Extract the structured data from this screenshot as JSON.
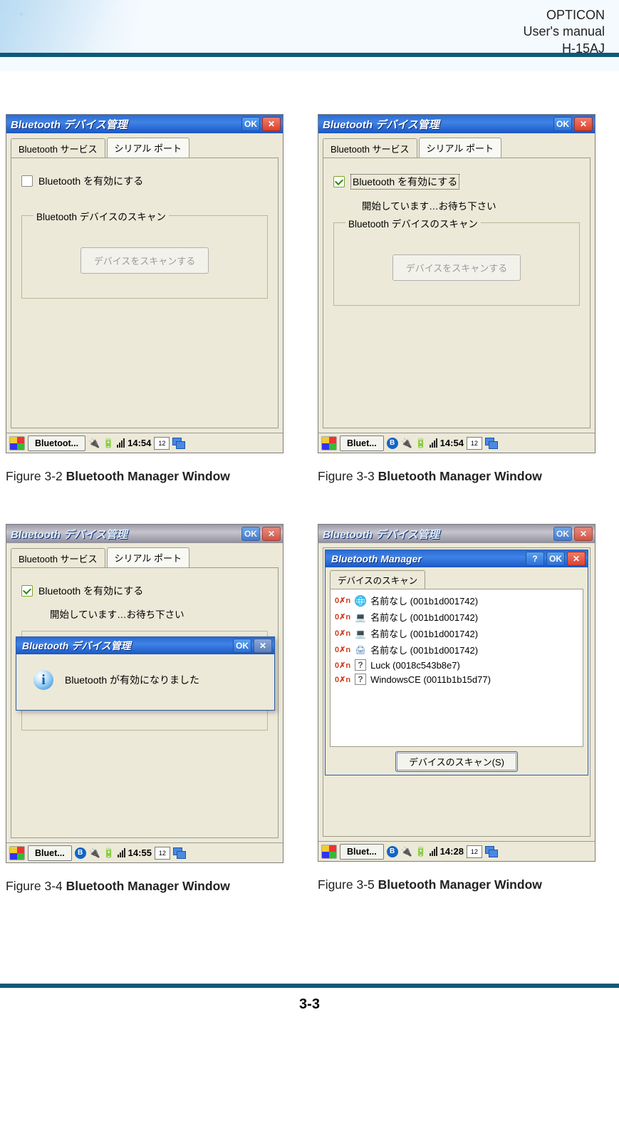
{
  "header": {
    "l1": "OPTICON",
    "l2": "User's manual",
    "l3": "H-15AJ"
  },
  "page_number": "3-3",
  "bluetooth_window_title": "Bluetooth デバイス管理",
  "bluetooth_manager_title": "Bluetooth Manager",
  "tabs": {
    "service": "Bluetooth サービス",
    "serial": "シリアル ポート"
  },
  "enable_checkbox": "Bluetooth を有効にする",
  "waiting_text": "開始しています…お待ち下さい",
  "scan_fieldset": "Bluetooth デバイスのスキャン",
  "scan_button": "デバイスをスキャンする",
  "ok_label": "OK",
  "msg_enabled": "Bluetooth が有効になりました",
  "scan_tab": "デバイスのスキャン",
  "scan_results": [
    {
      "icon": "globe",
      "name": "名前なし (001b1d001742)"
    },
    {
      "icon": "pc",
      "name": "名前なし (001b1d001742)"
    },
    {
      "icon": "pc",
      "name": "名前なし (001b1d001742)"
    },
    {
      "icon": "printer",
      "name": "名前なし (001b1d001742)"
    },
    {
      "icon": "q",
      "name": "Luck (0018c543b8e7)"
    },
    {
      "icon": "q",
      "name": "WindowsCE (0011b1b15d77)"
    }
  ],
  "scan_again": "デバイスのスキャン(S)",
  "taskbar": {
    "label_long": "Bluetoot...",
    "label_short": "Bluet...",
    "times": {
      "fig32": "14:54",
      "fig33": "14:54",
      "fig34": "14:55",
      "fig35": "14:28"
    },
    "sip": "12"
  },
  "captions": {
    "fig32_a": "Figure 3-2 ",
    "fig32_b": "Bluetooth Manager Window",
    "fig33_a": "Figure 3-3 ",
    "fig33_b": "Bluetooth Manager Window",
    "fig34_a": "Figure 3-4 ",
    "fig34_b": "Bluetooth Manager Window",
    "fig35_a": "Figure 3-5 ",
    "fig35_b": "Bluetooth Manager Window"
  }
}
